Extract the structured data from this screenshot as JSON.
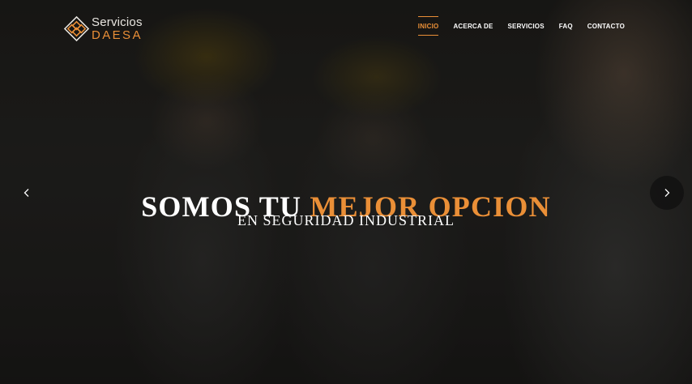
{
  "brand": {
    "name_top": "Servicios",
    "name_bottom": "DAESA",
    "logo_icon": "diamond-logo-icon",
    "accent_color": "#ea8f37"
  },
  "nav": {
    "items": [
      {
        "label": "INICIO",
        "active": true
      },
      {
        "label": "ACERCA DE",
        "active": false
      },
      {
        "label": "SERVICIOS",
        "active": false
      },
      {
        "label": "FAQ",
        "active": false
      },
      {
        "label": "CONTACTO",
        "active": false
      }
    ]
  },
  "hero": {
    "headline_plain": "SOMOS TU ",
    "headline_accent": "MEJOR OPCION",
    "subheadline": "EN SEGURIDAD INDUSTRIAL",
    "prev_icon": "chevron-left-icon",
    "next_icon": "chevron-right-icon"
  }
}
